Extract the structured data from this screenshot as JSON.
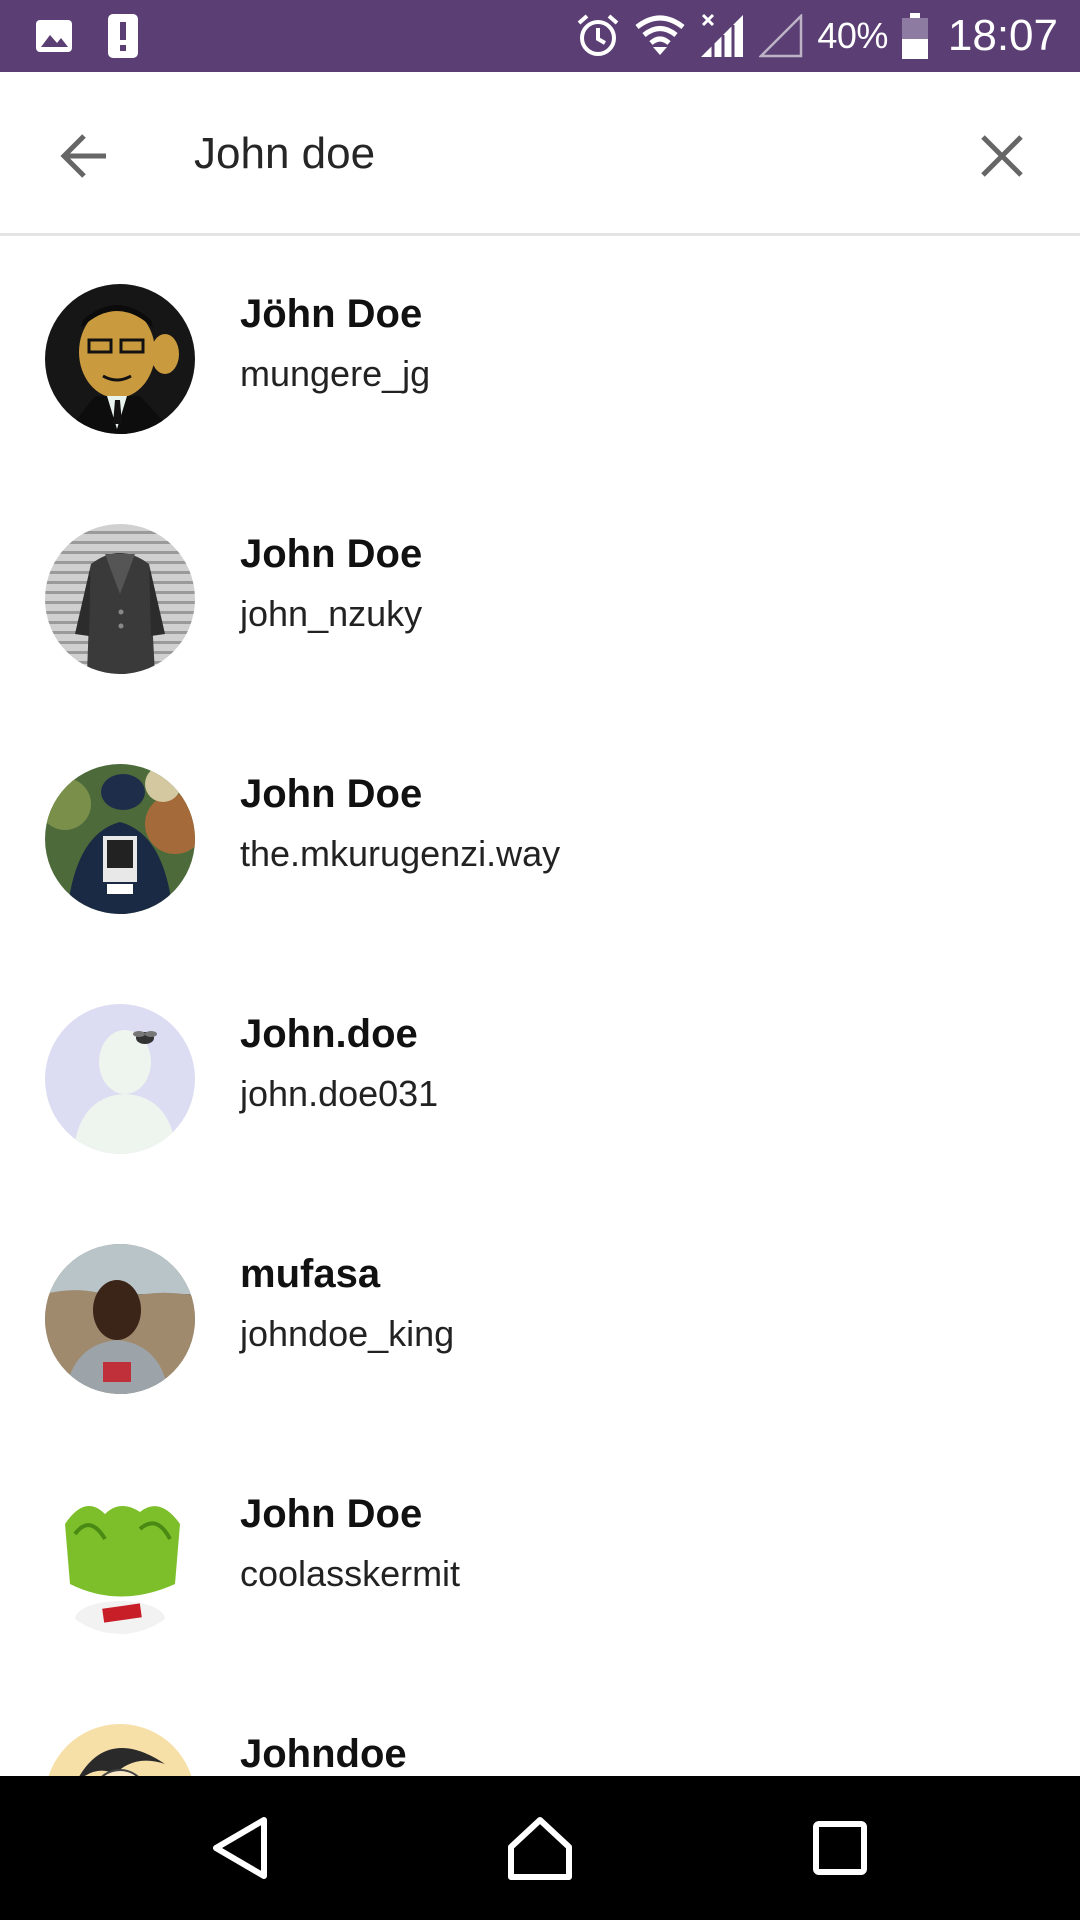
{
  "status_bar": {
    "background": "#5b3f74",
    "left_icons": [
      "gallery-icon",
      "alert-icon"
    ],
    "right_icons": [
      "alarm-icon",
      "wifi-icon",
      "cell-signal-icon",
      "cell-signal-empty-icon",
      "battery-icon"
    ],
    "battery_percent": "40%",
    "time": "18:07"
  },
  "search": {
    "query": "John doe",
    "back_icon": "arrow-back-icon",
    "clear_icon": "close-icon"
  },
  "results": [
    {
      "name": "Jöhn Doe",
      "username": "mungere_jg",
      "avatar": "cartoon-man-avatar"
    },
    {
      "name": "John Doe",
      "username": "john_nzuky",
      "avatar": "suit-photo-avatar"
    },
    {
      "name": "John Doe",
      "username": "the.mkurugenzi.way",
      "avatar": "jacket-photo-avatar"
    },
    {
      "name": "John.doe",
      "username": "john.doe031",
      "avatar": "default-silhouette-avatar"
    },
    {
      "name": "mufasa",
      "username": "johndoe_king",
      "avatar": "man-portrait-avatar"
    },
    {
      "name": "John Doe",
      "username": "coolasskermit",
      "avatar": "kermit-avatar"
    },
    {
      "name": "Johndoe",
      "username": "",
      "avatar": "anime-avatar"
    }
  ],
  "nav_bar": {
    "buttons": [
      "back-triangle-icon",
      "home-icon",
      "recents-icon"
    ]
  }
}
